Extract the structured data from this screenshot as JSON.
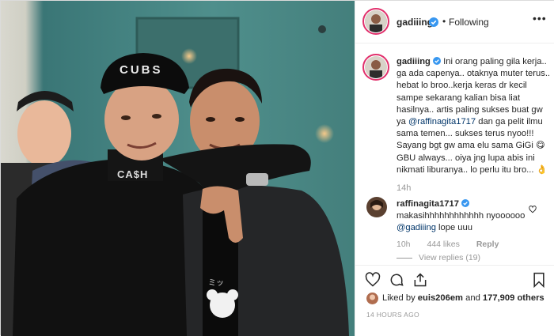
{
  "post": {
    "username": "gadiiing",
    "dot": "•",
    "follow_status": "Following",
    "more": "•••"
  },
  "caption": {
    "username": "gadiiing",
    "text_1": "Ini orang paling gila kerja.. ga ada capenya.. otaknya muter terus.. hebat lo broo..kerja keras dr kecil sampe sekarang kalian bisa liat hasilnya.. artis paling sukses buat gw ya ",
    "mention": "@raffinagita1717",
    "text_2": " dan ga pelit ilmu sama temen... sukses terus nyoo!!! Sayang bgt gw ama elu sama GiGi 😋 GBU always... oiya jng lupa abis ini nikmati liburanya.. lo perlu itu bro... 👌",
    "time": "14h"
  },
  "comment": {
    "username": "raffinagita1717",
    "text": "makasihhhhhhhhhhhh nyoooooo ",
    "mention": "@gadiiing",
    "text_2": " lope uuu",
    "time": "10h",
    "likes": "444 likes",
    "reply": "Reply",
    "view_replies": "View replies (19)"
  },
  "likes": {
    "prefix": "Liked by ",
    "user": "euis206em",
    "middle": " and ",
    "count": "177,909 others"
  },
  "timestamp": "14 HOURS AGO",
  "colors": {
    "verified": "#3897f0",
    "mention": "#003569",
    "muted": "#999999",
    "text": "#262626"
  },
  "icons": [
    "heart-icon",
    "comment-icon",
    "share-icon",
    "bookmark-icon",
    "verified-badge-icon",
    "more-options-icon"
  ]
}
